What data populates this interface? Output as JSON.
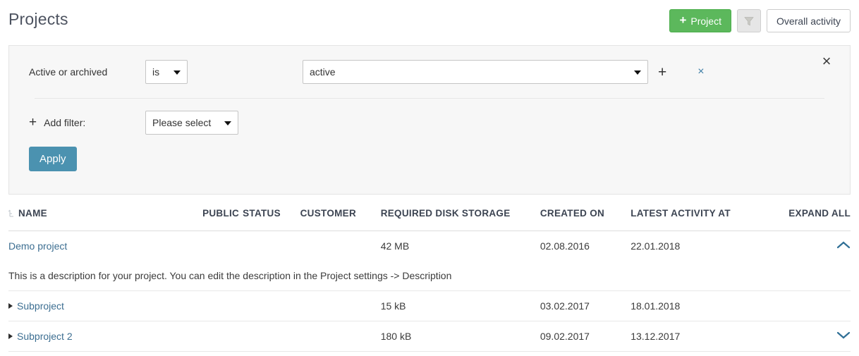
{
  "header": {
    "title": "Projects",
    "new_project_label": "Project",
    "new_project_plus": "+",
    "filter_icon_name": "funnel-icon",
    "overall_activity_label": "Overall activity",
    "accent_green": "#5cb85c"
  },
  "filter_panel": {
    "close_glyph": "×",
    "row": {
      "label": "Active or archived",
      "operator_value": "is",
      "value": "active",
      "add_value_glyph": "+",
      "remove_glyph": "×"
    },
    "add_filter": {
      "plus_glyph": "+",
      "label": "Add filter:",
      "select_value": "Please select"
    },
    "apply_label": "Apply",
    "apply_color": "#4b92b0"
  },
  "table": {
    "columns": [
      {
        "key": "name",
        "label": "NAME"
      },
      {
        "key": "public",
        "label": "PUBLIC"
      },
      {
        "key": "status",
        "label": "STATUS"
      },
      {
        "key": "customer",
        "label": "CUSTOMER"
      },
      {
        "key": "disk",
        "label": "REQUIRED DISK STORAGE"
      },
      {
        "key": "created",
        "label": "CREATED ON"
      },
      {
        "key": "latest",
        "label": "LATEST ACTIVITY AT"
      },
      {
        "key": "expand",
        "label": "EXPAND ALL"
      }
    ],
    "rows": [
      {
        "name": "Demo project",
        "public": "",
        "status": "",
        "customer": "",
        "disk": "42 MB",
        "created": "02.08.2016",
        "latest": "22.01.2018",
        "expand_state": "collapse",
        "indent": 0,
        "description": "This is a description for your project. You can edit the description in the Project settings -> Description"
      },
      {
        "name": "Subproject",
        "public": "",
        "status": "",
        "customer": "",
        "disk": "15 kB",
        "created": "03.02.2017",
        "latest": "18.01.2018",
        "expand_state": "none",
        "indent": 1,
        "description": ""
      },
      {
        "name": "Subproject 2",
        "public": "",
        "status": "",
        "customer": "",
        "disk": "180 kB",
        "created": "09.02.2017",
        "latest": "13.12.2017",
        "expand_state": "expand",
        "indent": 2,
        "description": ""
      }
    ]
  }
}
